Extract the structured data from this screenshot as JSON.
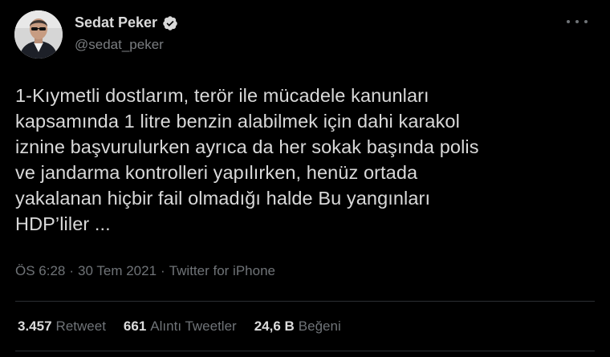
{
  "author": {
    "display_name": "Sedat Peker",
    "handle": "@sedat_peker",
    "verified_icon": "verified-badge-icon",
    "avatar_icon": "profile-photo"
  },
  "more_icon": "more-options-icon",
  "tweet": {
    "text": "1-Kıymetli dostlarım, terör ile mücadele kanunları\nkapsamında 1 litre benzin alabilmek için dahi karakol\niznine başvurulurken ayrıca da her sokak başında polis\nve jandarma kontrolleri yapılırken, henüz ortada\nyakalanan hiçbir fail olmadığı halde Bu yangınları\nHDP’liler ...",
    "time": "ÖS 6:28",
    "date": "30 Tem 2021",
    "separator": "·",
    "source": "Twitter for iPhone"
  },
  "stats": [
    {
      "count": "3.457",
      "label": "Retweet"
    },
    {
      "count": "661",
      "label": "Alıntı Tweetler"
    },
    {
      "count": "24,6 B",
      "label": "Beğeni"
    }
  ],
  "colors": {
    "background": "#000000",
    "text": "#d9d9d9",
    "muted": "#6f7377",
    "divider": "#2b2f33"
  }
}
